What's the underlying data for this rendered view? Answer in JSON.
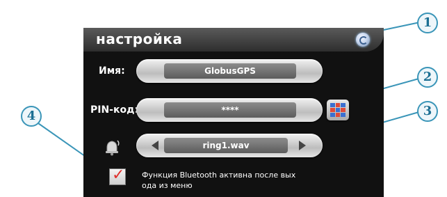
{
  "screen": {
    "title": "настройка",
    "name_label": "Имя:",
    "name_value": "GlobusGPS",
    "pin_label": "PIN-код:",
    "pin_value": "****",
    "ringtone_value": "ring1.wav",
    "bluetooth_checkbox_checked": true,
    "bluetooth_text_line1": "Функция Bluetooth активна после вых",
    "bluetooth_text_line2": "ода из меню"
  },
  "callouts": {
    "c1": "1",
    "c2": "2",
    "c3": "3",
    "c4": "4"
  },
  "icons": {
    "return": "return-icon",
    "keypad": "keypad-icon",
    "bell": "bell-icon",
    "checkmark": "checkmark-icon"
  },
  "colors": {
    "callout_border": "#3a95b8",
    "callout_text": "#1c6f93",
    "checkmark": "#e0312d"
  }
}
